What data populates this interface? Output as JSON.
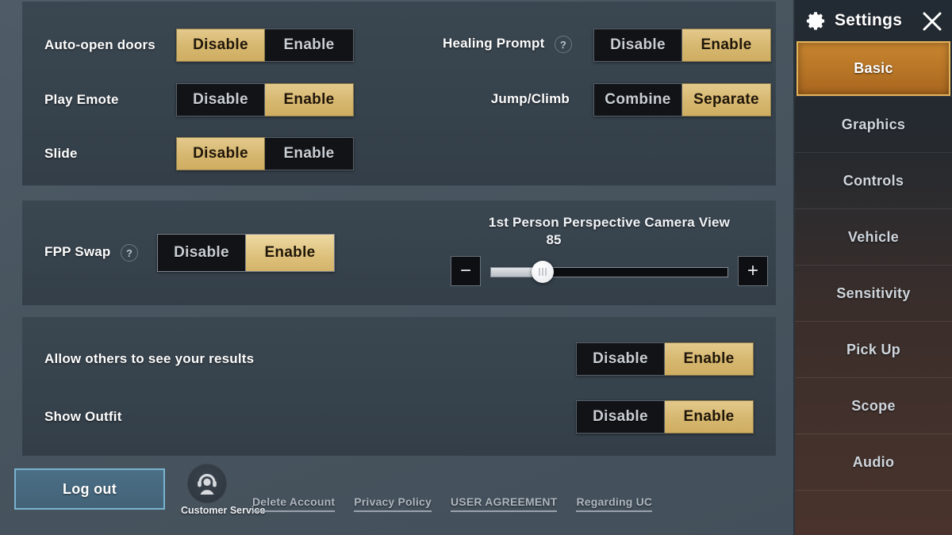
{
  "panels": {
    "basic": {
      "left_rows": [
        {
          "label": "Auto-open doors",
          "help": false,
          "options": [
            "Disable",
            "Enable"
          ],
          "selected": 0
        },
        {
          "label": "Play Emote",
          "help": false,
          "options": [
            "Disable",
            "Enable"
          ],
          "selected": 1
        },
        {
          "label": "Slide",
          "help": false,
          "options": [
            "Disable",
            "Enable"
          ],
          "selected": 0
        }
      ],
      "right_rows": [
        {
          "label": "Healing Prompt",
          "help": true,
          "help_icon": "question-mark-icon",
          "options": [
            "Disable",
            "Enable"
          ],
          "selected": 1
        },
        {
          "label": "Jump/Climb",
          "help": false,
          "options": [
            "Combine",
            "Separate"
          ],
          "selected": 1
        }
      ]
    },
    "fpp": {
      "row": {
        "label": "FPP Swap",
        "help": true,
        "help_icon": "question-mark-icon",
        "options": [
          "Disable",
          "Enable"
        ],
        "selected": 1
      },
      "slider": {
        "title": "1st Person Perspective Camera View",
        "value": "85",
        "decrement_label": "−",
        "increment_label": "+",
        "percent": 22
      }
    },
    "privacy": {
      "rows": [
        {
          "label": "Allow others to see your results",
          "options": [
            "Disable",
            "Enable"
          ],
          "selected": 1
        },
        {
          "label": "Show Outfit",
          "options": [
            "Disable",
            "Enable"
          ],
          "selected": 1
        }
      ]
    }
  },
  "bottom": {
    "logout_label": "Log out",
    "customer_service": {
      "label": "Customer Service",
      "icon": "headset-support-icon"
    },
    "links": [
      {
        "label": "Delete Account"
      },
      {
        "label": "Privacy Policy"
      },
      {
        "label": "USER AGREEMENT"
      },
      {
        "label": "Regarding UC"
      }
    ]
  },
  "sidebar": {
    "title": "Settings",
    "gear_icon": "gear-icon",
    "close_icon": "close-icon",
    "items": [
      {
        "label": "Basic",
        "active": true
      },
      {
        "label": "Graphics",
        "active": false
      },
      {
        "label": "Controls",
        "active": false
      },
      {
        "label": "Vehicle",
        "active": false
      },
      {
        "label": "Sensitivity",
        "active": false
      },
      {
        "label": "Pick Up",
        "active": false
      },
      {
        "label": "Scope",
        "active": false
      },
      {
        "label": "Audio",
        "active": false
      }
    ]
  },
  "colors": {
    "gold_selected": "#d6b76f",
    "dark_option": "#111317",
    "panel_bg": "#36424c",
    "page_bg": "#4a5763",
    "accent_orange": "#b97727",
    "accent_gold_border": "#e4b45c",
    "logout_blue": "#4b6f86",
    "logout_border": "#79b3cf"
  }
}
